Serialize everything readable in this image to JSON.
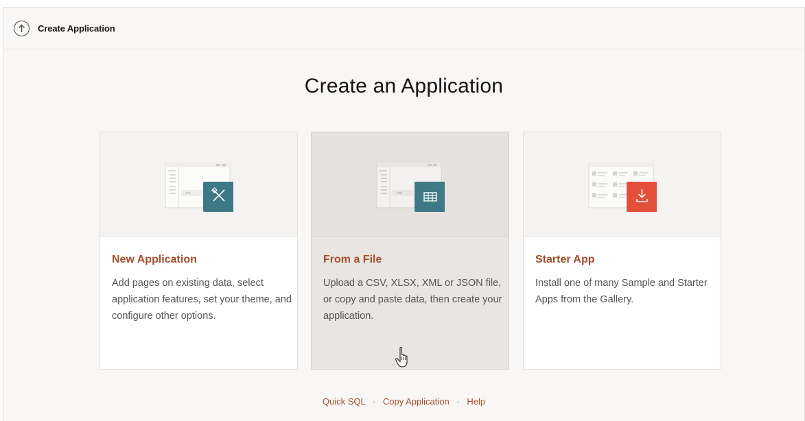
{
  "topbar": {
    "title": "Create Application",
    "up_icon": "arrow-up-circle-icon"
  },
  "page": {
    "heading": "Create an Application"
  },
  "cards": [
    {
      "title": "New Application",
      "description": "Add pages on existing data, select application features, set your theme, and configure other options.",
      "badge_icon": "wrench-pencil-icon",
      "badge_color": "#3e7a85"
    },
    {
      "title": "From a File",
      "description": "Upload a CSV, XLSX, XML or JSON file, or copy and paste data, then create your application.",
      "badge_icon": "table-grid-icon",
      "badge_color": "#3e7a85"
    },
    {
      "title": "Starter App",
      "description": "Install one of many Sample and Starter Apps from the Gallery.",
      "badge_icon": "download-icon",
      "badge_color": "#e2503a"
    }
  ],
  "footer": {
    "links": [
      "Quick SQL",
      "Copy Application",
      "Help"
    ],
    "separator": "·"
  },
  "colors": {
    "accent": "#a24f2e",
    "teal": "#3e7a85",
    "red": "#e2503a"
  }
}
